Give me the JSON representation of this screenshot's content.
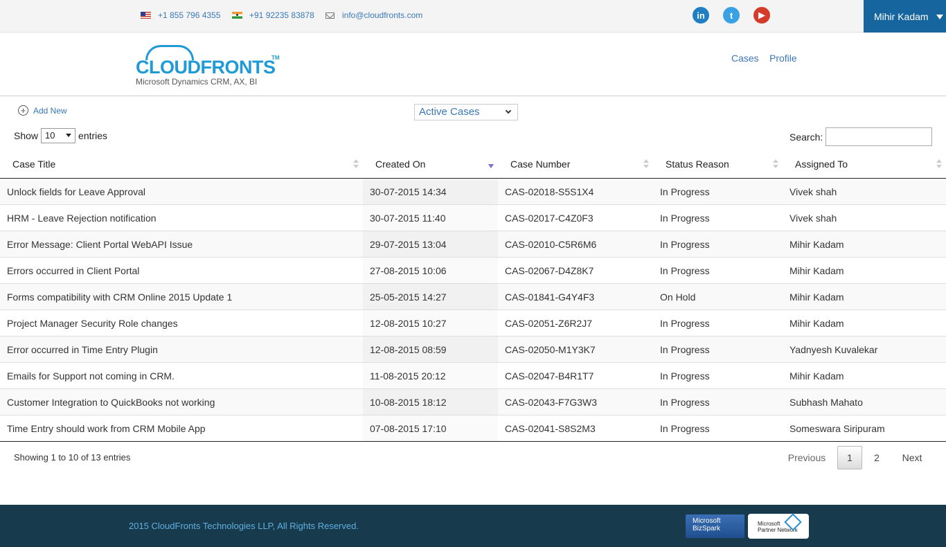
{
  "topbar": {
    "phone_us": "+1 855 796 4355",
    "phone_in": "+91 92235 83878",
    "email": "info@cloudfronts.com",
    "social": [
      {
        "icon": "linkedin-icon",
        "glyph": "in"
      },
      {
        "icon": "twitter-icon",
        "glyph": "t"
      },
      {
        "icon": "youtube-icon",
        "glyph": "▶"
      }
    ],
    "user_name": "Mihir Kadam"
  },
  "header": {
    "logo_text": "CLOUDFRONTS",
    "logo_tm": "TM",
    "tagline": "Microsoft Dynamics CRM, AX, BI",
    "nav": [
      "Cases",
      "Profile"
    ]
  },
  "controls": {
    "add_new": "Add New",
    "view_selected": "Active Cases",
    "show_label": "Show",
    "page_length": "10",
    "entries_label": "entries",
    "search_label": "Search:",
    "search_value": ""
  },
  "table": {
    "columns": [
      "Case Title",
      "Created On",
      "Case Number",
      "Status Reason",
      "Assigned To"
    ],
    "rows": [
      [
        "Unlock fields for Leave Approval",
        "30-07-2015 14:34",
        "CAS-02018-S5S1X4",
        "In Progress",
        "Vivek shah"
      ],
      [
        "HRM - Leave Rejection notification",
        "30-07-2015 11:40",
        "CAS-02017-C4Z0F3",
        "In Progress",
        "Vivek shah"
      ],
      [
        "Error Message: Client Portal WebAPI Issue",
        "29-07-2015 13:04",
        "CAS-02010-C5R6M6",
        "In Progress",
        "Mihir Kadam"
      ],
      [
        "Errors occurred in Client Portal",
        "27-08-2015 10:06",
        "CAS-02067-D4Z8K7",
        "In Progress",
        "Mihir Kadam"
      ],
      [
        "Forms compatibility with CRM Online 2015 Update 1",
        "25-05-2015 14:27",
        "CAS-01841-G4Y4F3",
        "On Hold",
        "Mihir Kadam"
      ],
      [
        "Project Manager Security Role changes",
        "12-08-2015 10:27",
        "CAS-02051-Z6R2J7",
        "In Progress",
        "Mihir Kadam"
      ],
      [
        "Error occurred in Time Entry Plugin",
        "12-08-2015 08:59",
        "CAS-02050-M1Y3K7",
        "In Progress",
        "Yadnyesh Kuvalekar"
      ],
      [
        "Emails for Support not coming in CRM.",
        "11-08-2015 20:12",
        "CAS-02047-B4R1T7",
        "In Progress",
        "Mihir Kadam"
      ],
      [
        "Customer Integration to QuickBooks not working",
        "10-08-2015 18:12",
        "CAS-02043-F7G3W3",
        "In Progress",
        "Subhash Mahato"
      ],
      [
        "Time Entry should work from CRM Mobile App",
        "07-08-2015 17:10",
        "CAS-02041-S8S2M3",
        "In Progress",
        "Someswara Siripuram"
      ]
    ],
    "sorted_column": "Created On",
    "sort_direction": "descending"
  },
  "pagination": {
    "info": "Showing 1 to 10 of 13 entries",
    "previous": "Previous",
    "pages": [
      "1",
      "2"
    ],
    "current_page": "1",
    "next": "Next"
  },
  "footer": {
    "copyright": "2015 CloudFronts Technologies LLP, All Rights Reserved.",
    "badge_bizspark_line1": "Microsoft",
    "badge_bizspark_line2": "BizSpark",
    "badge_mpn_line1": "Microsoft",
    "badge_mpn_line2": "Partner Network"
  },
  "colors": {
    "accent": "#3a78b8",
    "user_menu": "#17659e",
    "footer": "#183a4d",
    "logo": "#1e9ad6"
  }
}
